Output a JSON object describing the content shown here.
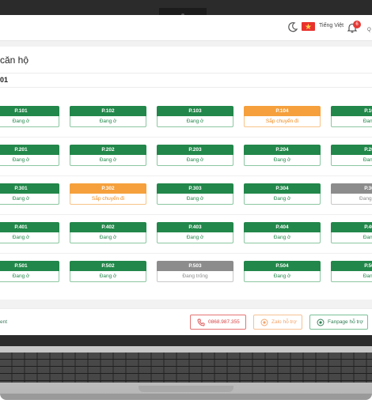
{
  "header": {
    "language": "Tiếng Việt",
    "notification_count": "6",
    "user_truncated": "Q"
  },
  "page": {
    "title": "căn hộ",
    "floor_label": "01"
  },
  "rooms": [
    [
      {
        "code": "P.101",
        "status": "Đang ở",
        "state": "occupied"
      },
      {
        "code": "P.102",
        "status": "Đang ở",
        "state": "occupied"
      },
      {
        "code": "P.103",
        "status": "Đang ở",
        "state": "occupied"
      },
      {
        "code": "P.104",
        "status": "Sắp chuyển đi",
        "state": "moving"
      },
      {
        "code": "P.10",
        "status": "Đang",
        "state": "occupied"
      }
    ],
    [
      {
        "code": "P.201",
        "status": "Đang ở",
        "state": "occupied"
      },
      {
        "code": "P.202",
        "status": "Đang ở",
        "state": "occupied"
      },
      {
        "code": "P.203",
        "status": "Đang ở",
        "state": "occupied"
      },
      {
        "code": "P.204",
        "status": "Đang ở",
        "state": "occupied"
      },
      {
        "code": "P.20",
        "status": "Đang",
        "state": "occupied"
      }
    ],
    [
      {
        "code": "P.301",
        "status": "Đang ở",
        "state": "occupied"
      },
      {
        "code": "P.302",
        "status": "Sắp chuyển đi",
        "state": "moving"
      },
      {
        "code": "P.303",
        "status": "Đang ở",
        "state": "occupied"
      },
      {
        "code": "P.304",
        "status": "Đang ở",
        "state": "occupied"
      },
      {
        "code": "P.30",
        "status": "Đang trố",
        "state": "empty"
      }
    ],
    [
      {
        "code": "P.401",
        "status": "Đang ở",
        "state": "occupied"
      },
      {
        "code": "P.402",
        "status": "Đang ở",
        "state": "occupied"
      },
      {
        "code": "P.403",
        "status": "Đang ở",
        "state": "occupied"
      },
      {
        "code": "P.404",
        "status": "Đang ở",
        "state": "occupied"
      },
      {
        "code": "P.40",
        "status": "Đang",
        "state": "occupied"
      }
    ],
    [
      {
        "code": "P.501",
        "status": "Đang ở",
        "state": "occupied"
      },
      {
        "code": "P.502",
        "status": "Đang ở",
        "state": "occupied"
      },
      {
        "code": "P.503",
        "status": "Đang trống",
        "state": "empty"
      },
      {
        "code": "P.504",
        "status": "Đang ở",
        "state": "occupied"
      },
      {
        "code": "P.50",
        "status": "Đang",
        "state": "occupied"
      }
    ]
  ],
  "footer": {
    "left_text": "ent",
    "phone_label": "0868.987.355",
    "zalo_label": "Zalo hỗ trợ",
    "fanpage_label": "Fanpage hỗ trợ"
  },
  "colors": {
    "occupied": "#22874a",
    "moving": "#f5a03c",
    "empty": "#8c8c8c"
  },
  "icons": [
    "moon-icon",
    "vietnam-flag-icon",
    "bell-icon",
    "phone-icon",
    "zalo-icon",
    "fanpage-icon"
  ]
}
